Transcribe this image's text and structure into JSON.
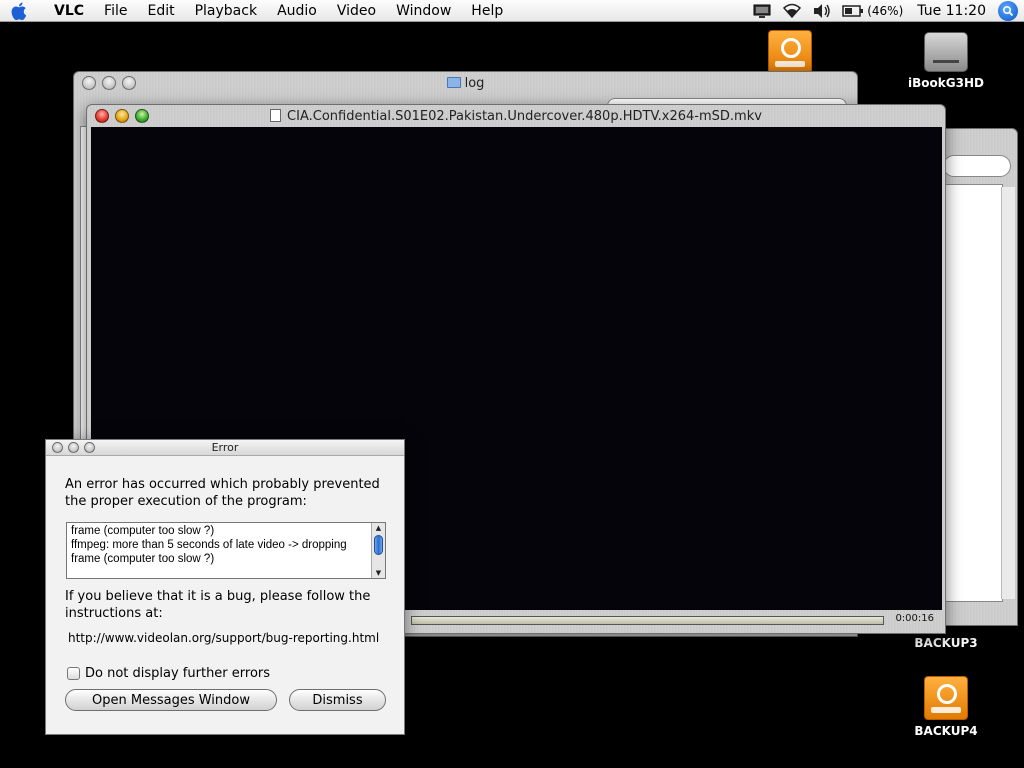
{
  "menubar": {
    "app": "VLC",
    "items": [
      "File",
      "Edit",
      "Playback",
      "Audio",
      "Video",
      "Window",
      "Help"
    ],
    "battery": "(46%)",
    "clock": "Tue 11:20"
  },
  "desktop": {
    "icons": [
      "iBookG3HD",
      "BACKUP3",
      "BACKUP4"
    ]
  },
  "finder_window": {
    "title": "log"
  },
  "vlc_window": {
    "title": "CIA.Confidential.S01E02.Pakistan.Undercover.480p.HDTV.x264-mSD.mkv",
    "time": "0:00:16"
  },
  "error_dialog": {
    "title": "Error",
    "message": "An error has occurred which probably prevented the proper execution of the program:",
    "log": [
      "frame (computer too slow ?)",
      "ffmpeg: more than 5 seconds of late video -> dropping",
      "frame (computer too slow ?)"
    ],
    "bug_message": "If you believe that it is a bug, please follow the instructions at:",
    "url": "http://www.videolan.org/support/bug-reporting.html",
    "checkbox_label": "Do not display further errors",
    "messages_button": "Open Messages Window",
    "dismiss_button": "Dismiss"
  }
}
